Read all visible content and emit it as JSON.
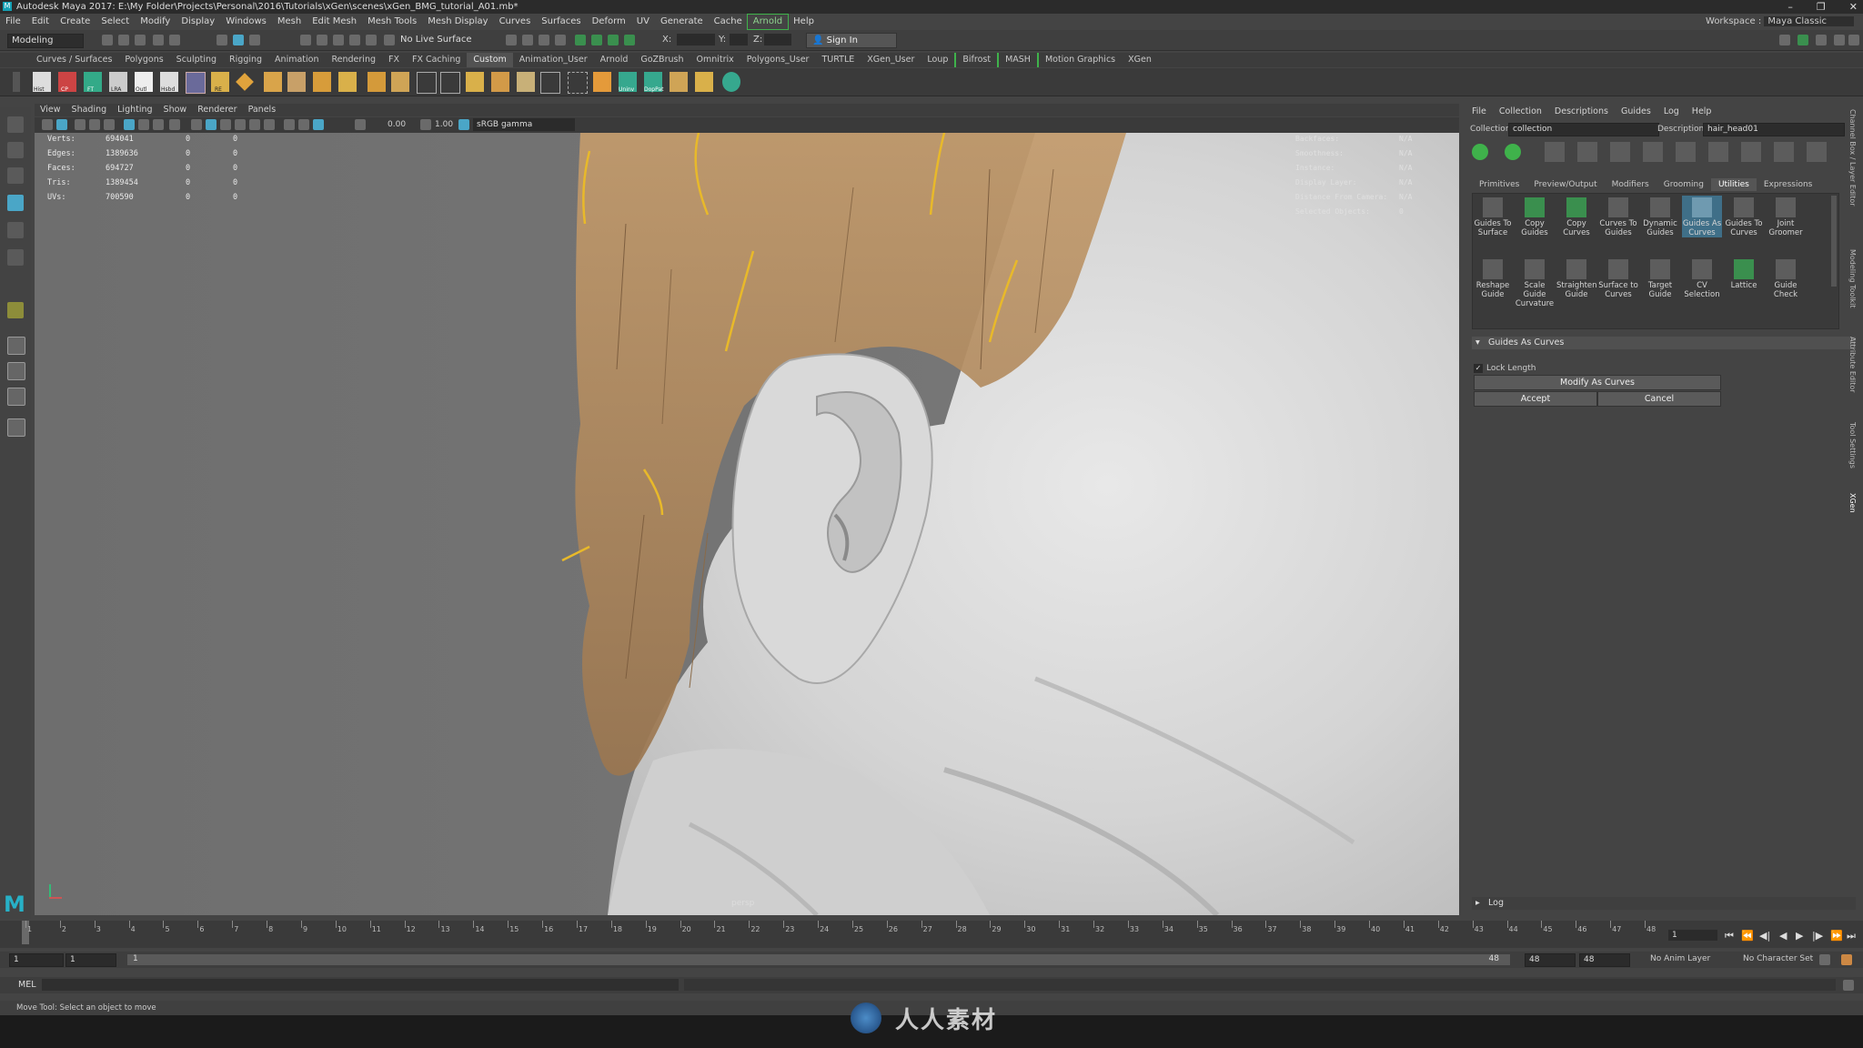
{
  "window": {
    "title": "Autodesk Maya 2017: E:\\My Folder\\Projects\\Personal\\2016\\Tutorials\\xGen\\scenes\\xGen_BMG_tutorial_A01.mb*",
    "controls": [
      "–",
      "❐",
      "✕"
    ]
  },
  "menubar": {
    "items": [
      "File",
      "Edit",
      "Create",
      "Select",
      "Modify",
      "Display",
      "Windows",
      "Mesh",
      "Edit Mesh",
      "Mesh Tools",
      "Mesh Display",
      "Curves",
      "Surfaces",
      "Deform",
      "UV",
      "Generate",
      "Cache",
      "Arnold",
      "Help"
    ],
    "workspace_label": "Workspace :",
    "workspace_value": "Maya Classic"
  },
  "statusline": {
    "mode": "Modeling",
    "live_surface": "No Live Surface",
    "x_label": "X:",
    "y_label": "Y:",
    "z_label": "Z:",
    "sign_in": "Sign In"
  },
  "shelf": {
    "tabs": [
      "Curves / Surfaces",
      "Polygons",
      "Sculpting",
      "Rigging",
      "Animation",
      "Rendering",
      "FX",
      "FX Caching",
      "Custom",
      "Animation_User",
      "Arnold",
      "GoZBrush",
      "Omnitrix",
      "Polygons_User",
      "TURTLE",
      "XGen_User",
      "Loup",
      "Bifrost",
      "MASH",
      "Motion Graphics",
      "XGen"
    ],
    "active": "Custom",
    "icon_labels": [
      "Hist",
      "CP",
      "FT",
      "LRA",
      "Outl",
      "Hsbd",
      "RE",
      "Uninv",
      "DopPat"
    ]
  },
  "viewport_menu": [
    "View",
    "Shading",
    "Lighting",
    "Show",
    "Renderer",
    "Panels"
  ],
  "viewport_toolbar": {
    "value_a": "0.00",
    "value_b": "1.00",
    "color_space": "sRGB gamma"
  },
  "hud": {
    "rows": [
      {
        "label": "Verts:",
        "a": "694041",
        "b": "0",
        "c": "0"
      },
      {
        "label": "Edges:",
        "a": "1389636",
        "b": "0",
        "c": "0"
      },
      {
        "label": "Faces:",
        "a": "694727",
        "b": "0",
        "c": "0"
      },
      {
        "label": "Tris:",
        "a": "1389454",
        "b": "0",
        "c": "0"
      },
      {
        "label": "UVs:",
        "a": "700590",
        "b": "0",
        "c": "0"
      }
    ],
    "right": [
      {
        "label": "Backfaces:",
        "value": "N/A"
      },
      {
        "label": "Smoothness:",
        "value": "N/A"
      },
      {
        "label": "Instance:",
        "value": "N/A"
      },
      {
        "label": "Display Layer:",
        "value": "N/A"
      },
      {
        "label": "Distance From Camera:",
        "value": "N/A"
      },
      {
        "label": "Selected Objects:",
        "value": "0"
      }
    ],
    "camera": "persp"
  },
  "xgen": {
    "menu": [
      "File",
      "Collection",
      "Descriptions",
      "Guides",
      "Log",
      "Help"
    ],
    "collection_label": "Collection",
    "collection_value": "collection",
    "description_label": "Description",
    "description_value": "hair_head01",
    "tabs": [
      "Primitives",
      "Preview/Output",
      "Modifiers",
      "Grooming",
      "Utilities",
      "Expressions"
    ],
    "active_tab": "Utilities",
    "tools_row1": [
      "Guides To Surface",
      "Copy Guides",
      "Copy Curves",
      "Curves To Guides",
      "Dynamic Guides",
      "Guides As Curves",
      "Guides To Curves",
      "Joint Groomer"
    ],
    "tools_row2": [
      "Reshape Guide",
      "Scale Guide Curvature",
      "Straighten Guide",
      "Surface to Curves",
      "Target Guide",
      "CV Selection",
      "Lattice",
      "Guide Check"
    ],
    "selected_tool": "Guides As Curves",
    "section_title": "Guides As Curves",
    "lock_length": "Lock Length",
    "modify_button": "Modify As Curves",
    "accept_button": "Accept",
    "cancel_button": "Cancel",
    "log_label": "Log"
  },
  "side_tabs": [
    "Channel Box / Layer Editor",
    "Modeling Toolkit",
    "Attribute Editor",
    "Tool Settings",
    "XGen"
  ],
  "timeline": {
    "ticks": [
      "1",
      "2",
      "3",
      "4",
      "5",
      "6",
      "7",
      "8",
      "9",
      "10",
      "11",
      "12",
      "13",
      "14",
      "15",
      "16",
      "17",
      "18",
      "19",
      "20",
      "21",
      "22",
      "23",
      "24",
      "25",
      "26",
      "27",
      "28",
      "29",
      "30",
      "31",
      "32",
      "33",
      "34",
      "35",
      "36",
      "37",
      "38",
      "39",
      "40",
      "41",
      "42",
      "43",
      "44",
      "45",
      "46",
      "47",
      "48"
    ],
    "current_frame": "1"
  },
  "range": {
    "start": "1",
    "playback_start": "1",
    "range_handle": "1",
    "range_end_handle": "48",
    "playback_end": "48",
    "end": "48",
    "anim_layer": "No Anim Layer",
    "character_set": "No Character Set"
  },
  "command": {
    "label": "MEL"
  },
  "help_line": "Move Tool: Select an object to move",
  "watermark": "人人素材",
  "colors": {
    "accent": "#4aa6c7",
    "hair": "#c9a574",
    "guide": "#e8b92a",
    "skin": "#d6d6d6"
  }
}
